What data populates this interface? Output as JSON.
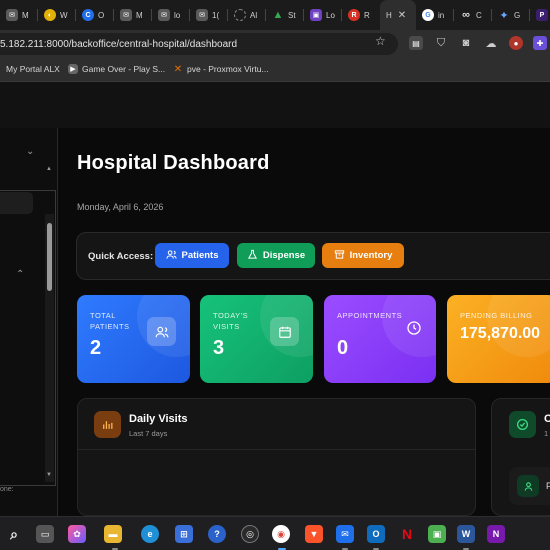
{
  "browser": {
    "tabs": [
      {
        "label": "M",
        "icon": "mail-icon",
        "color": "#5a5a5a"
      },
      {
        "label": "W",
        "icon": "yellow-circle-icon",
        "color": "#e2b007"
      },
      {
        "label": "O",
        "icon": "blue-circle-icon",
        "color": "#1f6feb"
      },
      {
        "label": "M",
        "icon": "mail-icon",
        "color": "#5a5a5a"
      },
      {
        "label": "lo",
        "icon": "mail-icon",
        "color": "#5a5a5a"
      },
      {
        "label": "1(",
        "icon": "mail-icon",
        "color": "#5a5a5a"
      },
      {
        "label": "Al",
        "icon": "loading-icon",
        "color": "#777777"
      },
      {
        "label": "St",
        "icon": "drive-icon",
        "color": "#34a853"
      },
      {
        "label": "Lo",
        "icon": "purple-square-icon",
        "color": "#6f42c1"
      },
      {
        "label": "R",
        "icon": "red-circle-icon",
        "color": "#d93025"
      },
      {
        "label": "H",
        "icon": "active-tab-icon",
        "color": "#2e2e2e",
        "close": "✕"
      },
      {
        "label": "in",
        "icon": "google-icon",
        "color": "#ffffff"
      },
      {
        "label": "C",
        "icon": "infinity-icon",
        "color": "#444444"
      },
      {
        "label": "G",
        "icon": "gemini-icon",
        "color": "#4285f4"
      },
      {
        "label": "N",
        "icon": "dark-square-icon",
        "color": "#3b1f6e"
      }
    ],
    "url": "5.182.211:8000/backoffice/central-hospital/dashboard",
    "bookmarks": [
      {
        "label": "My Portal ALX"
      },
      {
        "label": "Game Over - Play S..."
      },
      {
        "label": "pve - Proxmox Virtu..."
      }
    ]
  },
  "sidebar": {
    "footer_text": "one:"
  },
  "dashboard": {
    "title": "Hospital Dashboard",
    "date": "Monday, April 6, 2026",
    "quick_access": {
      "label": "Quick Access:",
      "buttons": [
        {
          "label": "Patients",
          "color": "#2563eb"
        },
        {
          "label": "Dispense",
          "color": "#0f9d58"
        },
        {
          "label": "Inventory",
          "color": "#e67e10"
        }
      ]
    },
    "stats": [
      {
        "title_line1": "TOTAL",
        "title_line2": "PATIENTS",
        "value": "2",
        "color": "#2563eb",
        "icon": "users-icon"
      },
      {
        "title_line1": "TODAY'S",
        "title_line2": "VISITS",
        "value": "3",
        "color": "#11a866",
        "icon": "calendar-icon"
      },
      {
        "title_line1": "APPOINTMENTS",
        "title_line2": "",
        "value": "0",
        "color": "#8b3dff",
        "icon": "clock-icon"
      },
      {
        "title_line1": "PENDING BILLING",
        "title_line2": "",
        "value": "175,870.00",
        "color": "#f59e0b",
        "icon": "billing-icon"
      }
    ],
    "daily_visits": {
      "title": "Daily Visits",
      "subtitle": "Last 7 days"
    },
    "right_panel": {
      "title": "C",
      "subtitle": "1",
      "row_label": "P"
    }
  }
}
